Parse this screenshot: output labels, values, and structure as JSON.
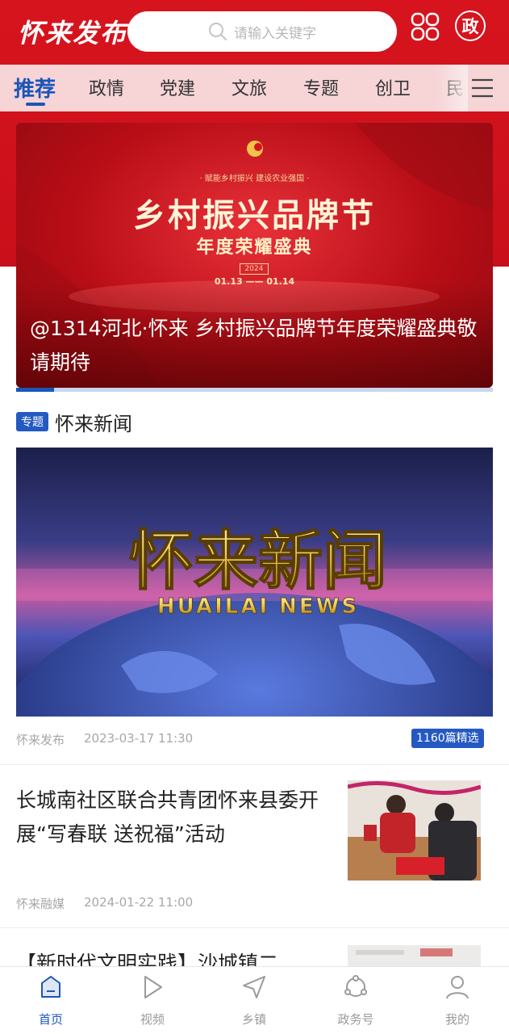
{
  "header": {
    "logo_text": "怀来发布",
    "search_placeholder": "请输入关键字",
    "gov_icon_char": "政",
    "accent_color": "#d7141e",
    "brand_blue": "#1a56b8"
  },
  "tabs": [
    {
      "label": "推荐",
      "active": true
    },
    {
      "label": "政情"
    },
    {
      "label": "党建"
    },
    {
      "label": "文旅"
    },
    {
      "label": "专题"
    },
    {
      "label": "创卫"
    },
    {
      "label": "民"
    }
  ],
  "banner": {
    "sub_slogan": "· 赋能乡村振兴  建设农业强国 ·",
    "title": "乡村振兴品牌节",
    "subtitle": "年度荣耀盛典",
    "year": "2024",
    "dates": "01.13  ——  01.14",
    "caption": "@1314河北·怀来 乡村振兴品牌节年度荣耀盛典敬请期待",
    "progress": 0.08
  },
  "topic": {
    "badge": "专题",
    "title": "怀来新闻",
    "image_title_cn": "怀来新闻",
    "image_title_en": "HUAILAI NEWS",
    "source": "怀来发布",
    "time": "2023-03-17 11:30",
    "count": "1160篇精选"
  },
  "articles": [
    {
      "title": "长城南社区联合共青团怀来县委开展“写春联 送祝福”活动",
      "source": "怀来融媒",
      "time": "2024-01-22 11:00"
    },
    {
      "title": "【新时代文明实践】沙城镇二"
    }
  ],
  "bottom_nav": [
    {
      "label": "首页",
      "icon": "home-icon",
      "active": true
    },
    {
      "label": "视频",
      "icon": "play-icon"
    },
    {
      "label": "乡镇",
      "icon": "send-icon"
    },
    {
      "label": "政务号",
      "icon": "share-icon"
    },
    {
      "label": "我的",
      "icon": "user-icon"
    }
  ]
}
